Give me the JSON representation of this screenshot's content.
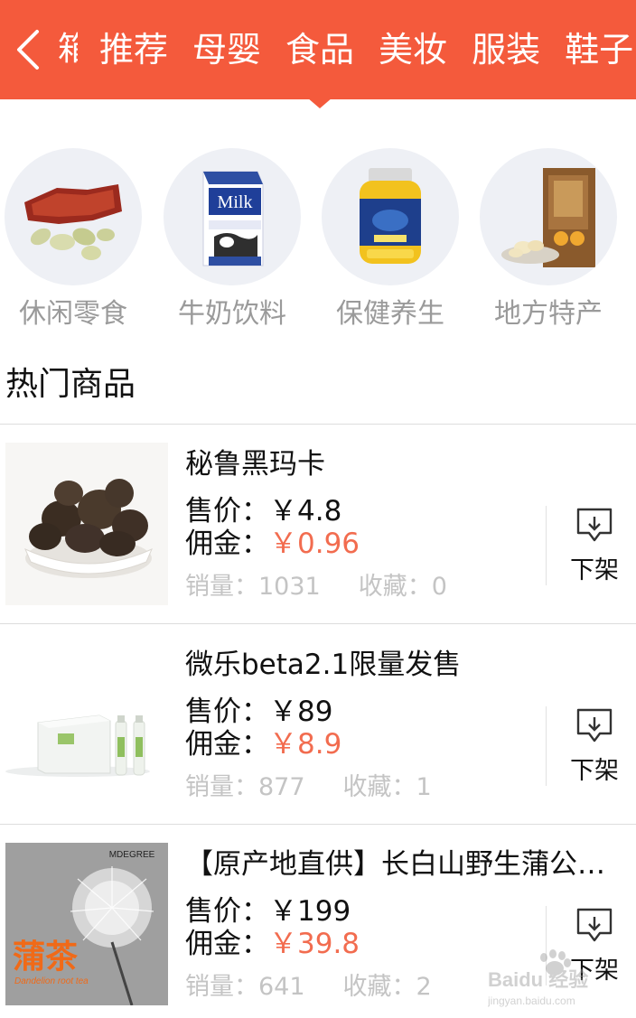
{
  "header": {
    "partial_tab": "箱",
    "tabs": [
      {
        "label": "推荐"
      },
      {
        "label": "母婴"
      },
      {
        "label": "食品",
        "active": true
      },
      {
        "label": "美妆"
      },
      {
        "label": "服装"
      },
      {
        "label": "鞋子"
      }
    ],
    "colors": {
      "bar": "#f45a3c"
    }
  },
  "categories": [
    {
      "label": "休闲零食",
      "icon": "snack-image"
    },
    {
      "label": "牛奶饮料",
      "icon": "milk-carton-image",
      "image_text": "Milk"
    },
    {
      "label": "保健养生",
      "icon": "supplement-bottle-image"
    },
    {
      "label": "地方特产",
      "icon": "specialty-box-image"
    }
  ],
  "hot": {
    "title": "热门商品",
    "price_label": "售价：",
    "commission_label": "佣金：",
    "sales_label": "销量：",
    "fav_label": "收藏：",
    "offshelf_label": "下架",
    "items": [
      {
        "name": "秘鲁黑玛卡",
        "price": "￥4.8",
        "commission": "￥0.96",
        "sales": "1031",
        "fav": "0"
      },
      {
        "name": "微乐beta2.1限量发售",
        "price": "￥89",
        "commission": "￥8.9",
        "sales": "877",
        "fav": "1"
      },
      {
        "name": "【原产地直供】长白山野生蒲公英根茶",
        "price": "￥199",
        "commission": "￥39.8",
        "sales": "641",
        "fav": "2",
        "image_text": "蒲茶",
        "image_subtext": "Dandelion root tea",
        "image_brand": "MDEGREE"
      }
    ]
  },
  "watermark": {
    "text": "Baidu 经验",
    "sub": "jingyan.baidu.com"
  },
  "colors": {
    "accent": "#f26c4f",
    "muted": "#c4c4c4",
    "category_bg": "#eef0f5"
  }
}
